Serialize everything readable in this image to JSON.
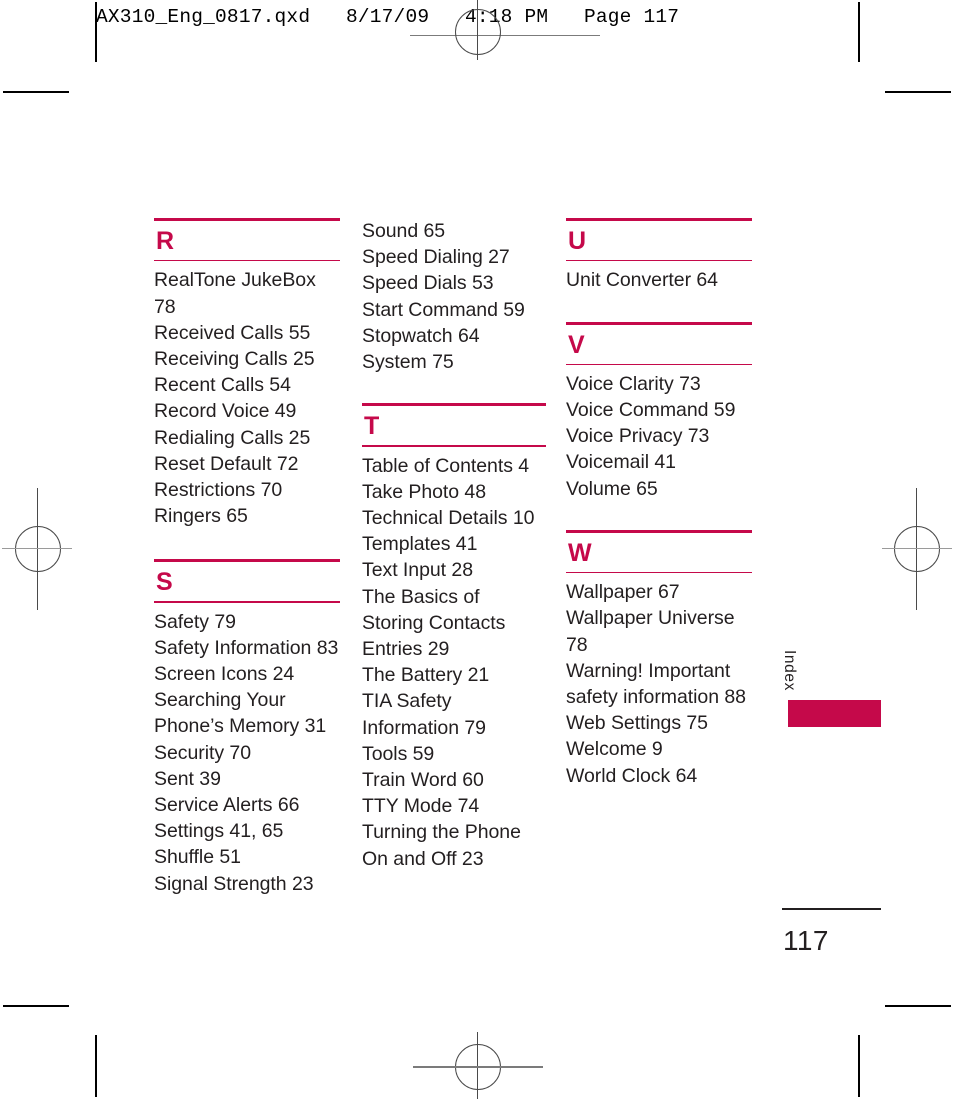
{
  "slug": {
    "text": "AX310_Eng_0817.qxd   8/17/09   4:18 PM   Page 117"
  },
  "colors": {
    "accent": "#c5094a",
    "text": "#231f20"
  },
  "page": {
    "folio": "117",
    "side_tab_label": "Index"
  },
  "columns": [
    {
      "id": "column-1",
      "sections": [
        {
          "letter": "R",
          "entries": [
            "RealTone JukeBox 78",
            "Received Calls 55",
            "Receiving Calls 25",
            "Recent Calls 54",
            "Record Voice 49",
            "Redialing Calls 25",
            "Reset Default 72",
            "Restrictions 70",
            "Ringers 65"
          ]
        },
        {
          "letter": "S",
          "entries": [
            "Safety 79",
            "Safety Information 83",
            "Screen Icons 24",
            "Searching Your Phone’s Memory 31",
            "Security 70",
            "Sent 39",
            "Service Alerts 66",
            "Settings 41, 65",
            "Shuffle 51",
            "Signal Strength 23"
          ]
        }
      ]
    },
    {
      "id": "column-2",
      "continuation": {
        "entries": [
          "Sound 65",
          "Speed Dialing 27",
          "Speed Dials 53",
          "Start Command 59",
          "Stopwatch 64",
          "System 75"
        ]
      },
      "sections": [
        {
          "letter": "T",
          "entries": [
            "Table of Contents 4",
            "Take Photo 48",
            "Technical Details 10",
            "Templates 41",
            "Text Input 28",
            "The Basics of Storing Contacts Entries 29",
            "The Battery 21",
            "TIA Safety Information 79",
            "Tools 59",
            "Train Word 60",
            "TTY Mode 74",
            "Turning the Phone On and Off 23"
          ]
        }
      ]
    },
    {
      "id": "column-3",
      "sections": [
        {
          "letter": "U",
          "entries": [
            "Unit Converter 64"
          ]
        },
        {
          "letter": "V",
          "entries": [
            "Voice Clarity 73",
            "Voice Command 59",
            "Voice Privacy 73",
            "Voicemail 41",
            "Volume 65"
          ]
        },
        {
          "letter": "W",
          "entries": [
            "Wallpaper 67",
            "Wallpaper Universe 78",
            "Warning! Important safety information 88",
            "Web Settings 75",
            "Welcome 9",
            "World Clock 64"
          ]
        }
      ]
    }
  ]
}
